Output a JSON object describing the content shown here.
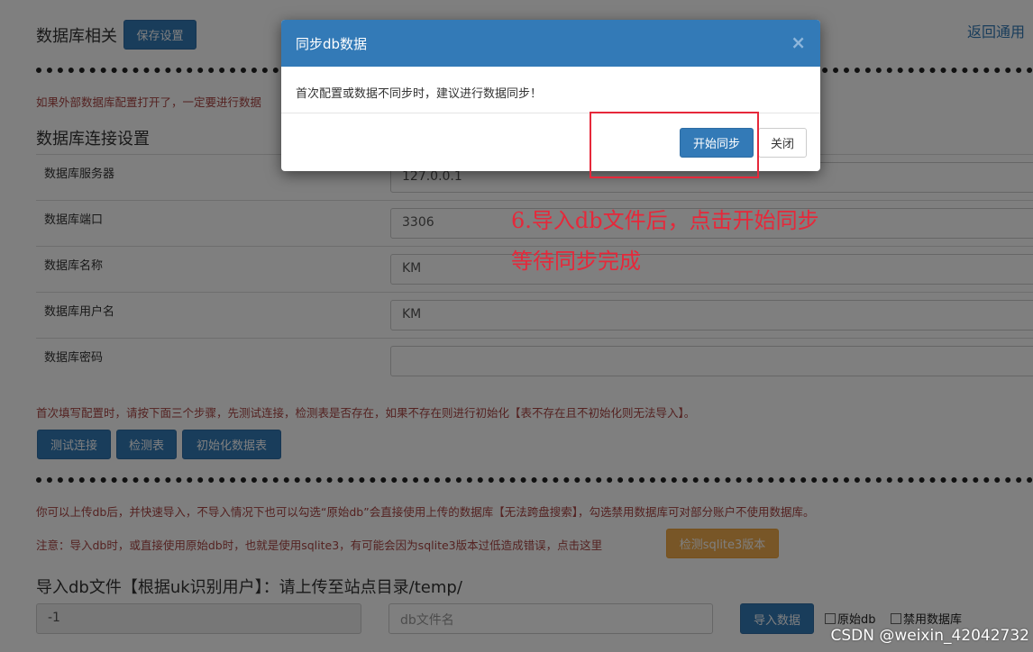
{
  "header": {
    "title": "数据库相关",
    "save_button": "保存设置",
    "back_link": "返回通用"
  },
  "warning_external_db": "如果外部数据库配置打开了，一定要进行数据",
  "connection": {
    "section_title": "数据库连接设置",
    "fields": [
      {
        "label": "数据库服务器",
        "value": "127.0.0.1"
      },
      {
        "label": "数据库端口",
        "value": "3306"
      },
      {
        "label": "数据库名称",
        "value": "KM"
      },
      {
        "label": "数据库用户名",
        "value": "KM"
      },
      {
        "label": "数据库密码",
        "value": ""
      }
    ]
  },
  "init_note": "首次填写配置时，请按下面三个步骤，先测试连接，检测表是否存在，如果不存在则进行初始化【表不存在且不初始化则无法导入】。",
  "actions": {
    "test_connection": "测试连接",
    "check_table": "检测表",
    "init_table": "初始化数据表"
  },
  "upload_note": "你可以上传db后，并快速导入，不导入情况下也可以勾选“原始db”会直接使用上传的数据库【无法跨盘搜索】，勾选禁用数据库可对部分账户不使用数据库。",
  "sqlite_note": "注意：导入db时，或直接使用原始db时，也就是使用sqlite3，有可能会因为sqlite3版本过低造成错误，点击这里",
  "sqlite_button": "检测sqlite3版本",
  "import": {
    "title": "导入db文件【根据uk识别用户】：请上传至站点目录/temp/",
    "uk_value": "-1",
    "file_placeholder": "db文件名",
    "import_button": "导入数据",
    "checkbox_raw_db": "原始db",
    "checkbox_disable_db": "禁用数据库"
  },
  "modal": {
    "title": "同步db数据",
    "close_icon": "×",
    "body": "首次配置或数据不同步时，建议进行数据同步！",
    "start_button": "开始同步",
    "close_button": "关闭"
  },
  "annotation": {
    "line1": "6.导入db文件后，点击开始同步",
    "line2": "等待同步完成"
  },
  "watermark": "CSDN @weixin_42042732",
  "colors": {
    "primary": "#337ab7",
    "warning": "#f0ad4e",
    "danger_text": "#a94442",
    "annotation_red": "#e6283a"
  }
}
